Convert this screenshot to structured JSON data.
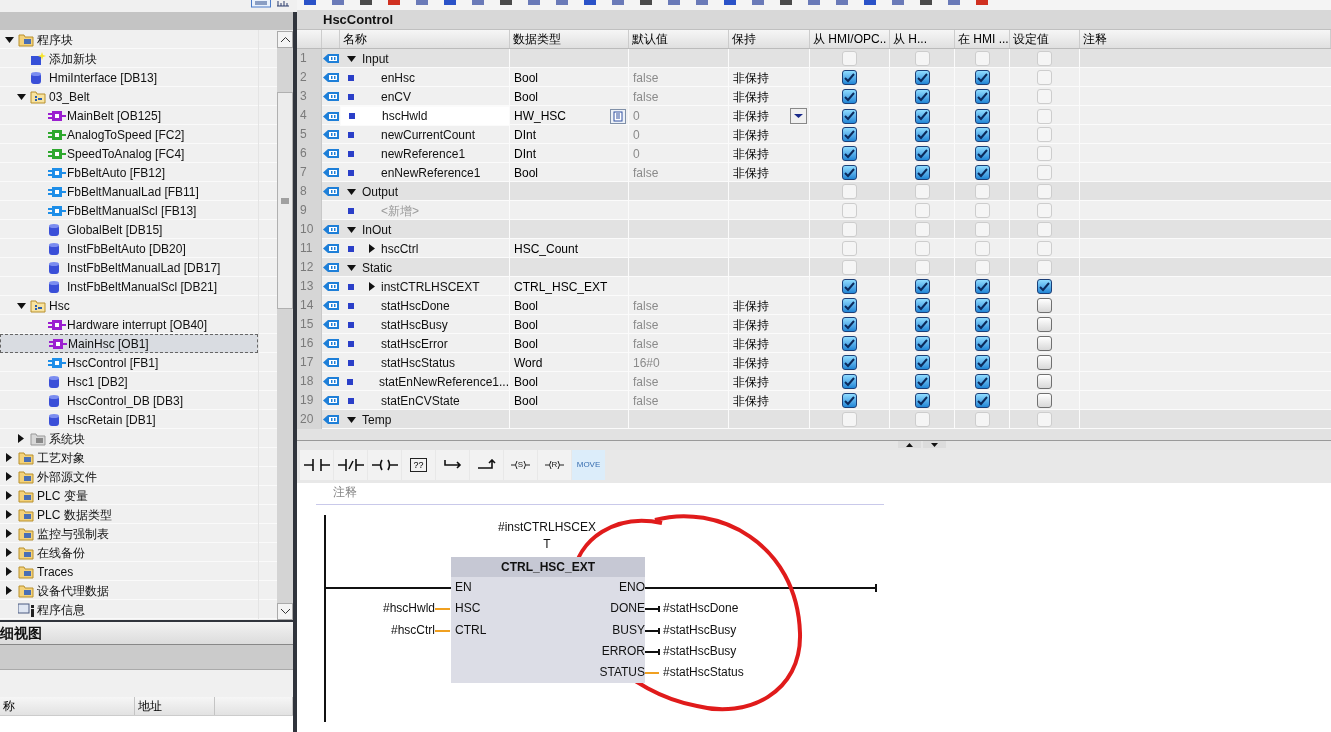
{
  "tree": [
    {
      "label": "程序块",
      "kind": "folder",
      "expanded": true,
      "selected": false,
      "children": [
        {
          "label": "添加新块",
          "kind": "add",
          "selected": false
        },
        {
          "label": "HmiInterface [DB13]",
          "kind": "db",
          "selected": false
        },
        {
          "label": "03_Belt",
          "kind": "group",
          "expanded": true,
          "selected": false,
          "children": [
            {
              "label": "MainBelt [OB125]",
              "kind": "ob",
              "selected": false
            },
            {
              "label": "AnalogToSpeed [FC2]",
              "kind": "fc",
              "selected": false
            },
            {
              "label": "SpeedToAnalog [FC4]",
              "kind": "fc",
              "selected": false
            },
            {
              "label": "FbBeltAuto [FB12]",
              "kind": "fb",
              "selected": false
            },
            {
              "label": "FbBeltManualLad [FB11]",
              "kind": "fb",
              "selected": false
            },
            {
              "label": "FbBeltManualScl [FB13]",
              "kind": "fb",
              "selected": false
            },
            {
              "label": "GlobalBelt [DB15]",
              "kind": "db",
              "selected": false
            },
            {
              "label": "InstFbBeltAuto [DB20]",
              "kind": "db",
              "selected": false
            },
            {
              "label": "InstFbBeltManualLad [DB17]",
              "kind": "db",
              "selected": false
            },
            {
              "label": "InstFbBeltManualScl [DB21]",
              "kind": "db",
              "selected": false
            }
          ]
        },
        {
          "label": "Hsc",
          "kind": "group",
          "expanded": true,
          "selected": false,
          "children": [
            {
              "label": "Hardware interrupt [OB40]",
              "kind": "ob",
              "selected": false
            },
            {
              "label": "MainHsc [OB1]",
              "kind": "ob",
              "selected": true
            },
            {
              "label": "HscControl [FB1]",
              "kind": "fb",
              "selected": false
            },
            {
              "label": "Hsc1 [DB2]",
              "kind": "db",
              "selected": false
            },
            {
              "label": "HscControl_DB [DB3]",
              "kind": "db",
              "selected": false
            },
            {
              "label": "HscRetain [DB1]",
              "kind": "db",
              "selected": false
            }
          ]
        },
        {
          "label": "系统块",
          "kind": "system",
          "expanded": false,
          "selected": false
        }
      ]
    },
    {
      "label": "工艺对象",
      "kind": "folder",
      "expanded": false,
      "selected": false
    },
    {
      "label": "外部源文件",
      "kind": "folder",
      "expanded": false,
      "selected": false
    },
    {
      "label": "PLC 变量",
      "kind": "folder",
      "expanded": false,
      "selected": false
    },
    {
      "label": "PLC 数据类型",
      "kind": "folder",
      "expanded": false,
      "selected": false
    },
    {
      "label": "监控与强制表",
      "kind": "folder",
      "expanded": false,
      "selected": false
    },
    {
      "label": "在线备份",
      "kind": "folder",
      "expanded": false,
      "selected": false
    },
    {
      "label": "Traces",
      "kind": "folder",
      "expanded": false,
      "selected": false
    },
    {
      "label": "设备代理数据",
      "kind": "folder",
      "expanded": false,
      "selected": false
    },
    {
      "label": "程序信息",
      "kind": "info",
      "selected": false
    }
  ],
  "details": {
    "title": "细视图",
    "columns": [
      "称",
      "地址"
    ]
  },
  "editor": {
    "title": "HscControl",
    "columns": [
      "名称",
      "数据类型",
      "默认值",
      "保持",
      "从 HMI/OPC..",
      "从 H...",
      "在 HMI ...",
      "设定值",
      "注释"
    ],
    "sections": [
      {
        "number": "1",
        "name": "Input",
        "expanded": true,
        "selected": false,
        "checks": [
          {
            "checked": false,
            "disabled": true
          },
          {
            "checked": false,
            "disabled": true
          },
          {
            "checked": false,
            "disabled": true
          },
          {
            "checked": false,
            "disabled": true
          }
        ],
        "children": [
          {
            "kind": "variable",
            "number": "2",
            "name": "enHsc",
            "type": "Bool",
            "default": "false",
            "retain": "非保持",
            "selected": false,
            "checks": [
              {
                "checked": true,
                "disabled": false
              },
              {
                "checked": true,
                "disabled": false
              },
              {
                "checked": true,
                "disabled": false
              },
              {
                "checked": false,
                "disabled": true
              }
            ]
          },
          {
            "kind": "variable",
            "number": "3",
            "name": "enCV",
            "type": "Bool",
            "default": "false",
            "retain": "非保持",
            "selected": false,
            "checks": [
              {
                "checked": true,
                "disabled": false
              },
              {
                "checked": true,
                "disabled": false
              },
              {
                "checked": true,
                "disabled": false
              },
              {
                "checked": false,
                "disabled": true
              }
            ]
          },
          {
            "kind": "variable",
            "number": "4",
            "name": "hscHwld",
            "type": "HW_HSC",
            "default": "0",
            "retain": "非保持",
            "selected": true,
            "checks": [
              {
                "checked": true,
                "disabled": false
              },
              {
                "checked": true,
                "disabled": false
              },
              {
                "checked": true,
                "disabled": false
              },
              {
                "checked": false,
                "disabled": true
              }
            ]
          },
          {
            "kind": "variable",
            "number": "5",
            "name": "newCurrentCount",
            "type": "DInt",
            "default": "0",
            "retain": "非保持",
            "selected": false,
            "checks": [
              {
                "checked": true,
                "disabled": false
              },
              {
                "checked": true,
                "disabled": false
              },
              {
                "checked": true,
                "disabled": false
              },
              {
                "checked": false,
                "disabled": true
              }
            ]
          },
          {
            "kind": "variable",
            "number": "6",
            "name": "newReference1",
            "type": "DInt",
            "default": "0",
            "retain": "非保持",
            "selected": false,
            "checks": [
              {
                "checked": true,
                "disabled": false
              },
              {
                "checked": true,
                "disabled": false
              },
              {
                "checked": true,
                "disabled": false
              },
              {
                "checked": false,
                "disabled": true
              }
            ]
          },
          {
            "kind": "variable",
            "number": "7",
            "name": "enNewReference1",
            "type": "Bool",
            "default": "false",
            "retain": "非保持",
            "selected": false,
            "checks": [
              {
                "checked": true,
                "disabled": false
              },
              {
                "checked": true,
                "disabled": false
              },
              {
                "checked": true,
                "disabled": false
              },
              {
                "checked": false,
                "disabled": true
              }
            ]
          }
        ]
      },
      {
        "number": "8",
        "name": "Output",
        "expanded": true,
        "selected": false,
        "checks": [
          {
            "checked": false,
            "disabled": true
          },
          {
            "checked": false,
            "disabled": true
          },
          {
            "checked": false,
            "disabled": true
          },
          {
            "checked": false,
            "disabled": true
          }
        ],
        "children": [
          {
            "kind": "placeholder",
            "number": "9",
            "name": "<新增>",
            "selected": false,
            "checks": [
              {
                "checked": false,
                "disabled": true
              },
              {
                "checked": false,
                "disabled": true
              },
              {
                "checked": false,
                "disabled": true
              },
              {
                "checked": false,
                "disabled": true
              }
            ]
          }
        ]
      },
      {
        "number": "10",
        "name": "InOut",
        "expanded": true,
        "selected": false,
        "checks": [
          {
            "checked": false,
            "disabled": true
          },
          {
            "checked": false,
            "disabled": true
          },
          {
            "checked": false,
            "disabled": true
          },
          {
            "checked": false,
            "disabled": true
          }
        ],
        "children": [
          {
            "kind": "variable",
            "number": "11",
            "name": "hscCtrl",
            "type": "HSC_Count",
            "expanded": false,
            "selected": false,
            "checks": [
              {
                "checked": false,
                "disabled": true
              },
              {
                "checked": false,
                "disabled": true
              },
              {
                "checked": false,
                "disabled": true
              },
              {
                "checked": false,
                "disabled": true
              }
            ]
          }
        ]
      },
      {
        "number": "12",
        "name": "Static",
        "expanded": true,
        "selected": false,
        "checks": [
          {
            "checked": false,
            "disabled": true
          },
          {
            "checked": false,
            "disabled": true
          },
          {
            "checked": false,
            "disabled": true
          },
          {
            "checked": false,
            "disabled": true
          }
        ],
        "children": [
          {
            "kind": "variable",
            "number": "13",
            "name": "instCTRLHSCEXT",
            "type": "CTRL_HSC_EXT",
            "expanded": false,
            "selected": false,
            "checks": [
              {
                "checked": true,
                "disabled": false
              },
              {
                "checked": true,
                "disabled": false
              },
              {
                "checked": true,
                "disabled": false
              },
              {
                "checked": true,
                "disabled": false
              }
            ]
          },
          {
            "kind": "variable",
            "number": "14",
            "name": "statHscDone",
            "type": "Bool",
            "default": "false",
            "retain": "非保持",
            "selected": false,
            "checks": [
              {
                "checked": true,
                "disabled": false
              },
              {
                "checked": true,
                "disabled": false
              },
              {
                "checked": true,
                "disabled": false
              },
              {
                "checked": false,
                "disabled": false
              }
            ]
          },
          {
            "kind": "variable",
            "number": "15",
            "name": "statHscBusy",
            "type": "Bool",
            "default": "false",
            "retain": "非保持",
            "selected": false,
            "checks": [
              {
                "checked": true,
                "disabled": false
              },
              {
                "checked": true,
                "disabled": false
              },
              {
                "checked": true,
                "disabled": false
              },
              {
                "checked": false,
                "disabled": false
              }
            ]
          },
          {
            "kind": "variable",
            "number": "16",
            "name": "statHscError",
            "type": "Bool",
            "default": "false",
            "retain": "非保持",
            "selected": false,
            "checks": [
              {
                "checked": true,
                "disabled": false
              },
              {
                "checked": true,
                "disabled": false
              },
              {
                "checked": true,
                "disabled": false
              },
              {
                "checked": false,
                "disabled": false
              }
            ]
          },
          {
            "kind": "variable",
            "number": "17",
            "name": "statHscStatus",
            "type": "Word",
            "default": "16#0",
            "retain": "非保持",
            "selected": false,
            "checks": [
              {
                "checked": true,
                "disabled": false
              },
              {
                "checked": true,
                "disabled": false
              },
              {
                "checked": true,
                "disabled": false
              },
              {
                "checked": false,
                "disabled": false
              }
            ]
          },
          {
            "kind": "variable",
            "number": "18",
            "name": "statEnNewReference1...",
            "type": "Bool",
            "default": "false",
            "retain": "非保持",
            "selected": false,
            "checks": [
              {
                "checked": true,
                "disabled": false
              },
              {
                "checked": true,
                "disabled": false
              },
              {
                "checked": true,
                "disabled": false
              },
              {
                "checked": false,
                "disabled": false
              }
            ]
          },
          {
            "kind": "variable",
            "number": "19",
            "name": "statEnCVState",
            "type": "Bool",
            "default": "false",
            "retain": "非保持",
            "selected": false,
            "checks": [
              {
                "checked": true,
                "disabled": false
              },
              {
                "checked": true,
                "disabled": false
              },
              {
                "checked": true,
                "disabled": false
              },
              {
                "checked": false,
                "disabled": false
              }
            ]
          }
        ]
      },
      {
        "number": "20",
        "name": "Temp",
        "expanded": true,
        "selected": false,
        "checks": [
          {
            "checked": false,
            "disabled": true
          },
          {
            "checked": false,
            "disabled": true
          },
          {
            "checked": false,
            "disabled": true
          },
          {
            "checked": false,
            "disabled": true
          }
        ]
      }
    ]
  },
  "instructions": [
    {
      "kind": "contact_no",
      "selected": false
    },
    {
      "kind": "contact_nc",
      "selected": false
    },
    {
      "kind": "coil",
      "selected": false
    },
    {
      "kind": "empty_box",
      "label": "??",
      "selected": false
    },
    {
      "kind": "branch_open",
      "selected": false
    },
    {
      "kind": "branch_close",
      "selected": false
    },
    {
      "kind": "coil_set",
      "label": "S",
      "selected": false
    },
    {
      "kind": "coil_reset",
      "label": "R",
      "selected": false
    },
    {
      "kind": "text",
      "label": "MOVE",
      "selected": true
    }
  ],
  "network": {
    "comment": "注释",
    "instance": "#instCTRLHSCEXT",
    "block": {
      "title": "CTRL_HSC_EXT",
      "inputs": [
        {
          "pin": "EN",
          "kind": "power"
        },
        {
          "pin": "HSC",
          "kind": "data",
          "operand": "#hscHwld"
        },
        {
          "pin": "CTRL",
          "kind": "data",
          "operand": "#hscCtrl"
        }
      ],
      "outputs": [
        {
          "pin": "ENO",
          "kind": "power"
        },
        {
          "pin": "DONE",
          "kind": "bool",
          "operand": "#statHscDone"
        },
        {
          "pin": "BUSY",
          "kind": "bool",
          "operand": "#statHscBusy"
        },
        {
          "pin": "ERROR",
          "kind": "bool",
          "operand": "#statHscBusy"
        },
        {
          "pin": "STATUS",
          "kind": "data",
          "operand": "#statHscStatus"
        }
      ]
    }
  }
}
